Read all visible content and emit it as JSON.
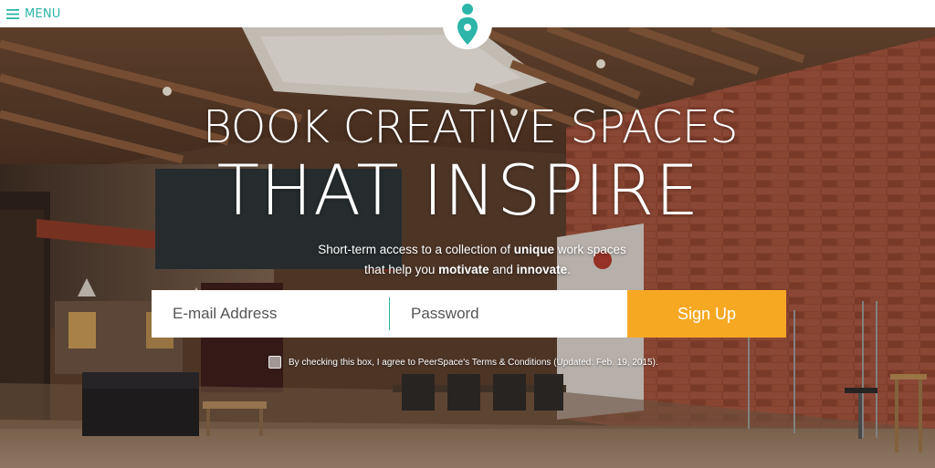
{
  "header": {
    "menu_label": "MENU",
    "menu_icon": "hamburger-icon",
    "logo_icon": "map-pin-icon",
    "accent_color": "#2cb5a8"
  },
  "hero": {
    "headline_line1": "BOOK CREATIVE SPACES",
    "headline_line2": "THAT INSPIRE",
    "sub_line1": {
      "before": "Short-term access to a collection of ",
      "bold": "unique",
      "after": " work spaces"
    },
    "sub_line2": {
      "before": "that help you ",
      "bold1": "motivate",
      "middle": " and ",
      "bold2": "innovate",
      "after": "."
    }
  },
  "form": {
    "email_placeholder": "E-mail Address",
    "password_placeholder": "Password",
    "signup_label": "Sign Up",
    "signup_color": "#f7a823"
  },
  "terms": {
    "text": "By checking this box, I agree to PeerSpace's Terms & Conditions (Updated: Feb. 19, 2015)."
  }
}
